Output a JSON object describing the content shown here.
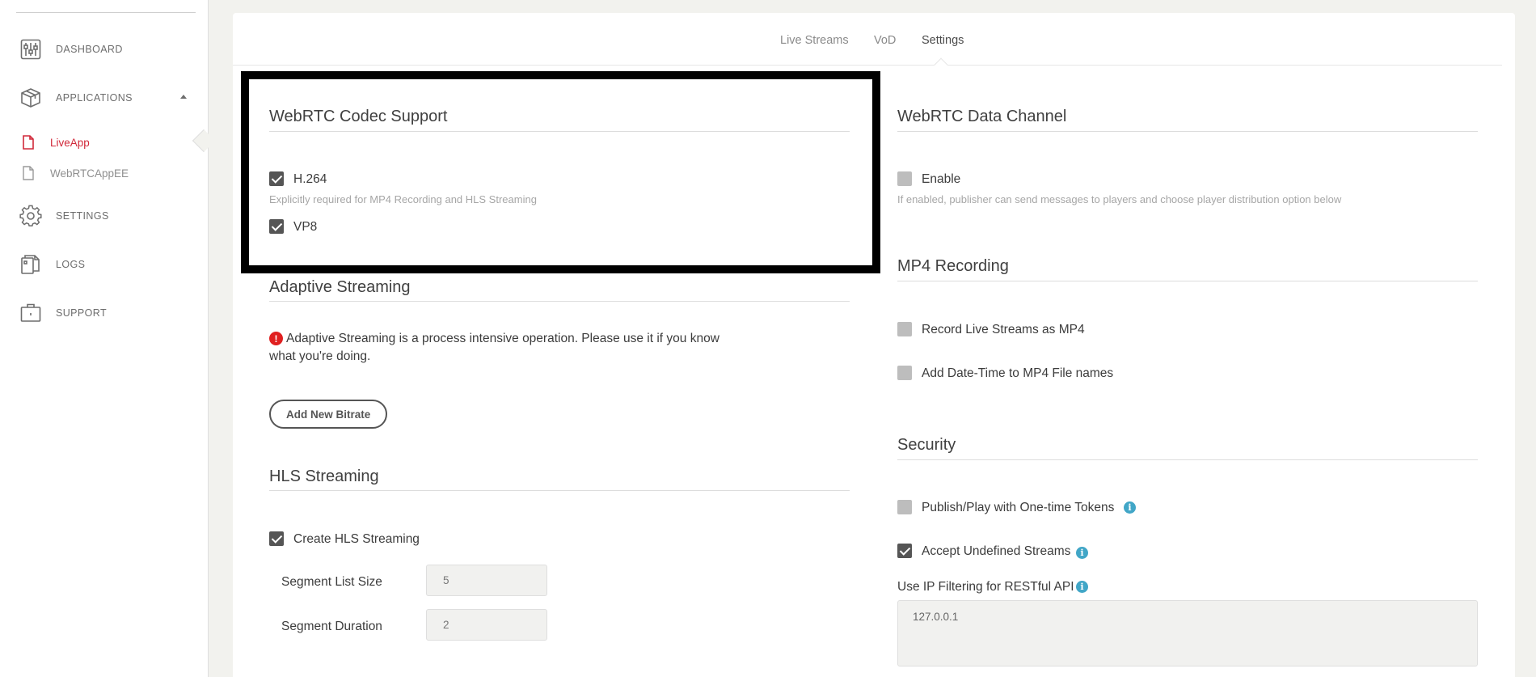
{
  "sidebar": {
    "items": [
      {
        "label": "DASHBOARD",
        "icon": "sliders-icon"
      },
      {
        "label": "APPLICATIONS",
        "icon": "cube-icon"
      },
      {
        "label": "SETTINGS",
        "icon": "gear-icon"
      },
      {
        "label": "LOGS",
        "icon": "files-icon"
      },
      {
        "label": "SUPPORT",
        "icon": "toolbox-icon"
      }
    ],
    "apps": [
      {
        "label": "LiveApp",
        "active": true
      },
      {
        "label": "WebRTCAppEE",
        "active": false
      }
    ]
  },
  "tabs": [
    "Live Streams",
    "VoD",
    "Settings"
  ],
  "active_tab": "Settings",
  "codec": {
    "title": "WebRTC Codec Support",
    "h264_label": "H.264",
    "h264_checked": true,
    "h264_help": "Explicitly required for MP4 Recording and HLS Streaming",
    "vp8_label": "VP8",
    "vp8_checked": true
  },
  "adaptive": {
    "title": "Adaptive Streaming",
    "warning": "Adaptive Streaming is a process intensive operation. Please use it if you know what you're doing.",
    "button": "Add New Bitrate"
  },
  "hls": {
    "title": "HLS Streaming",
    "create_label": "Create HLS Streaming",
    "create_checked": true,
    "segment_list_label": "Segment List Size",
    "segment_list_value": "5",
    "segment_duration_label": "Segment Duration",
    "segment_duration_value": "2"
  },
  "datachannel": {
    "title": "WebRTC Data Channel",
    "enable_label": "Enable",
    "enable_checked": false,
    "help": "If enabled, publisher can send messages to players and choose player distribution option below"
  },
  "mp4": {
    "title": "MP4 Recording",
    "record_label": "Record Live Streams as MP4",
    "datetime_label": "Add Date-Time to MP4 File names"
  },
  "security": {
    "title": "Security",
    "onetime_label": "Publish/Play with One-time Tokens",
    "undefined_label": "Accept Undefined Streams",
    "undefined_checked": true,
    "ipfilter_label": "Use IP Filtering for RESTful API",
    "ipfilter_value": "127.0.0.1"
  },
  "colors": {
    "accent_red": "#d1293a",
    "info_blue": "#41a6c7",
    "checkbox_dark": "#555555",
    "checkbox_off": "#bdbdbd"
  }
}
